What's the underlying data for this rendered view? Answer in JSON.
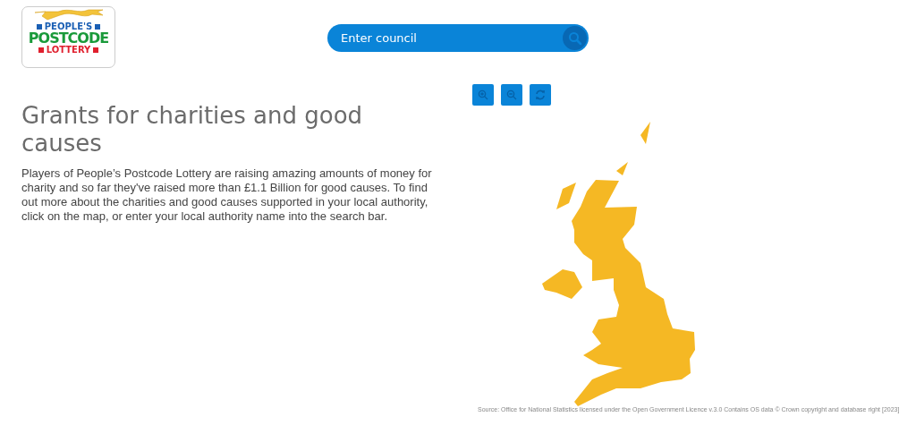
{
  "logo": {
    "lines": [
      "PEOPLE'S",
      "POSTCODE",
      "LOTTERY"
    ]
  },
  "search": {
    "placeholder": "Enter council"
  },
  "heading": "Grants for charities and good causes",
  "intro": "Players of People’s Postcode Lottery are raising amazing amounts of money for charity and so far they've raised more than £1.1 Billion for good causes. To find out more about the charities and good causes supported in your local authority, click on the map, or enter your local authority name into the search bar.",
  "map_source": "Source: Office for National Statistics licensed under the Open Government Licence v.3.0 Contains OS data © Crown copyright and database right [2023]"
}
